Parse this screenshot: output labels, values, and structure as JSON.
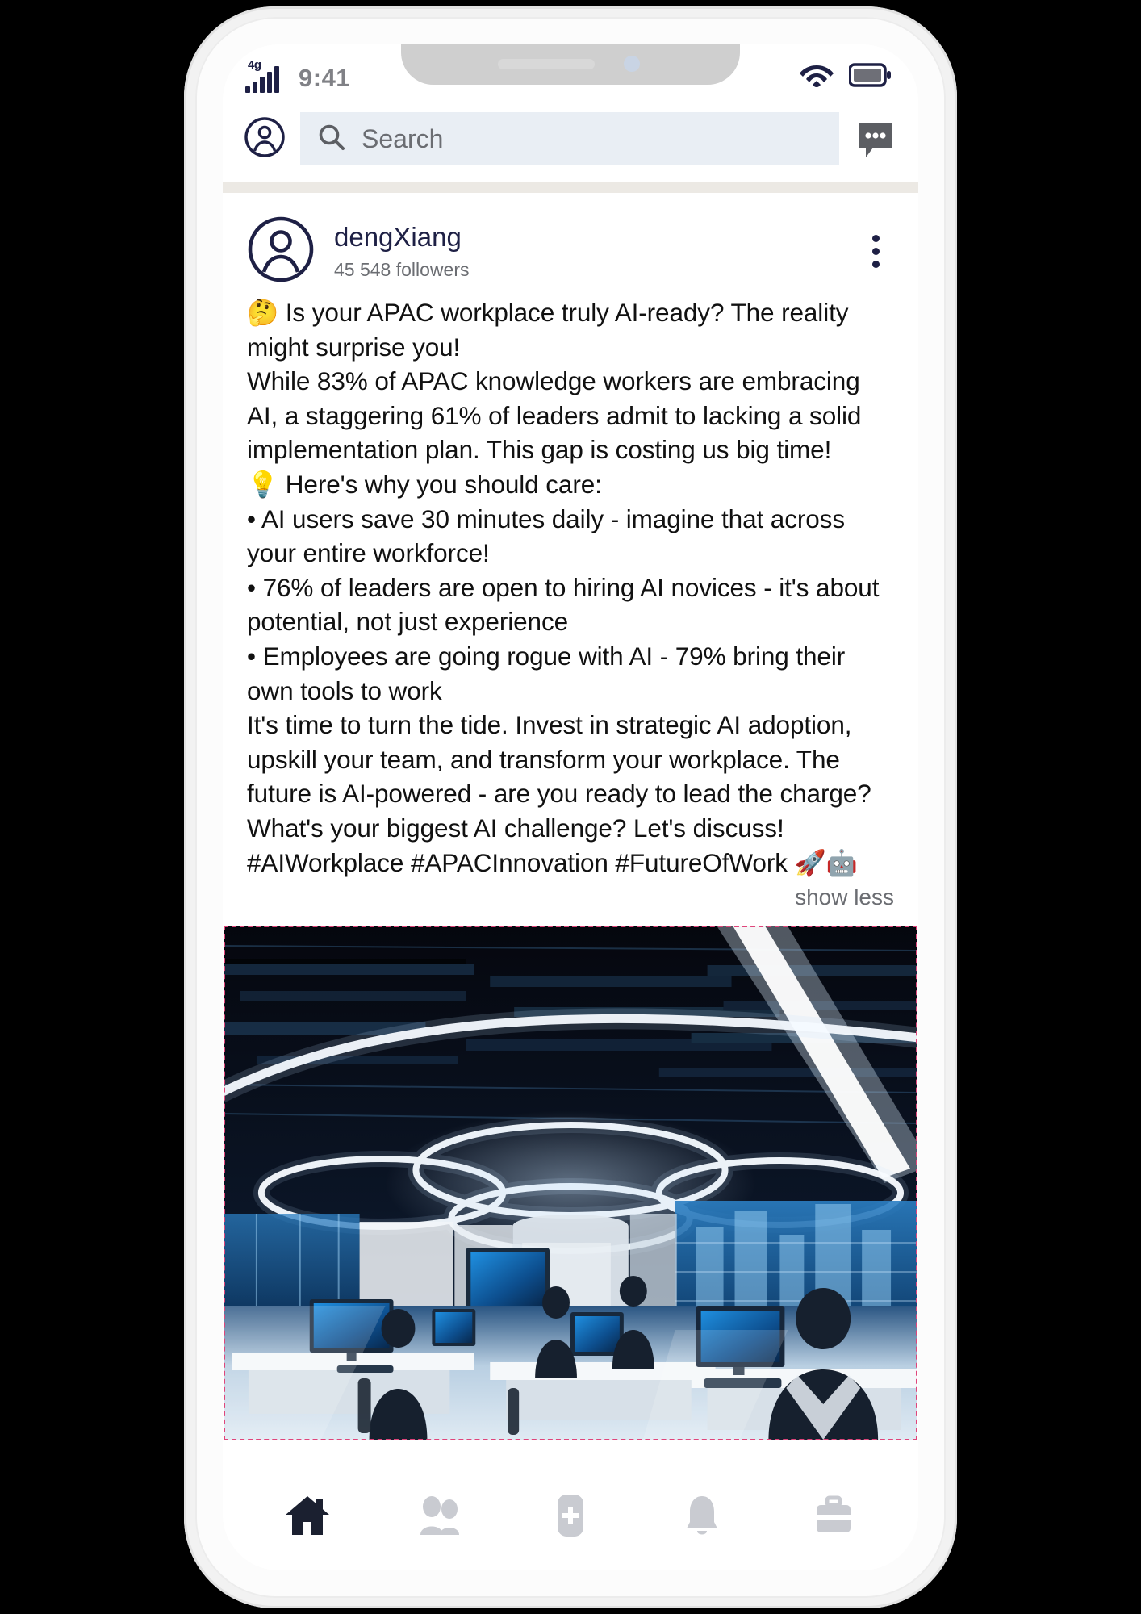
{
  "status_bar": {
    "network_label": "4g",
    "time": "9:41",
    "wifi_icon": "wifi-icon",
    "battery_icon": "battery-icon",
    "signal_icon": "signal-bars-icon"
  },
  "header": {
    "profile_icon": "profile-circle-icon",
    "search_icon": "search-icon",
    "search_value": "",
    "search_placeholder": "Search",
    "messaging_icon": "messaging-bubble-icon"
  },
  "post": {
    "avatar_icon": "avatar-placeholder-icon",
    "author": "dengXiang",
    "followers": "45 548 followers",
    "menu_icon": "kebab-menu-icon",
    "body": "🤔 Is your APAC workplace truly AI-ready? The reality might surprise you!\nWhile 83% of APAC knowledge workers are embracing AI, a staggering 61% of leaders admit to lacking a solid implementation plan. This gap is costing us big time!\n💡 Here's why you should care:\n• AI users save 30 minutes daily - imagine that across your entire workforce!\n• 76% of leaders are open to hiring AI novices - it's about potential, not just experience\n• Employees are going rogue with AI - 79% bring their own tools to work\nIt's time to turn the tide. Invest in strategic AI adoption, upskill your team, and transform your workplace. The future is AI-powered - are you ready to lead the charge?\nWhat's your biggest AI challenge? Let's discuss!\n#AIWorkplace #APACInnovation #FutureOfWork 🚀🤖",
    "show_less_label": "show less",
    "image_alt": "futuristic open-plan office with glowing circular ceiling lights and workers at blue monitors"
  },
  "bottom_nav": {
    "items": [
      {
        "name": "home",
        "icon": "home-icon",
        "active": true
      },
      {
        "name": "network",
        "icon": "people-icon",
        "active": false
      },
      {
        "name": "post",
        "icon": "plus-square-icon",
        "active": false
      },
      {
        "name": "notifications",
        "icon": "bell-icon",
        "active": false
      },
      {
        "name": "jobs",
        "icon": "briefcase-icon",
        "active": false
      }
    ]
  },
  "colors": {
    "brand_navy": "#1e2045",
    "muted_gray": "#6b6d72",
    "search_field": "#e9eef4",
    "divider": "#ece9e4",
    "nav_inactive": "#c9cbd1",
    "selection_dash": "#e0457b"
  }
}
